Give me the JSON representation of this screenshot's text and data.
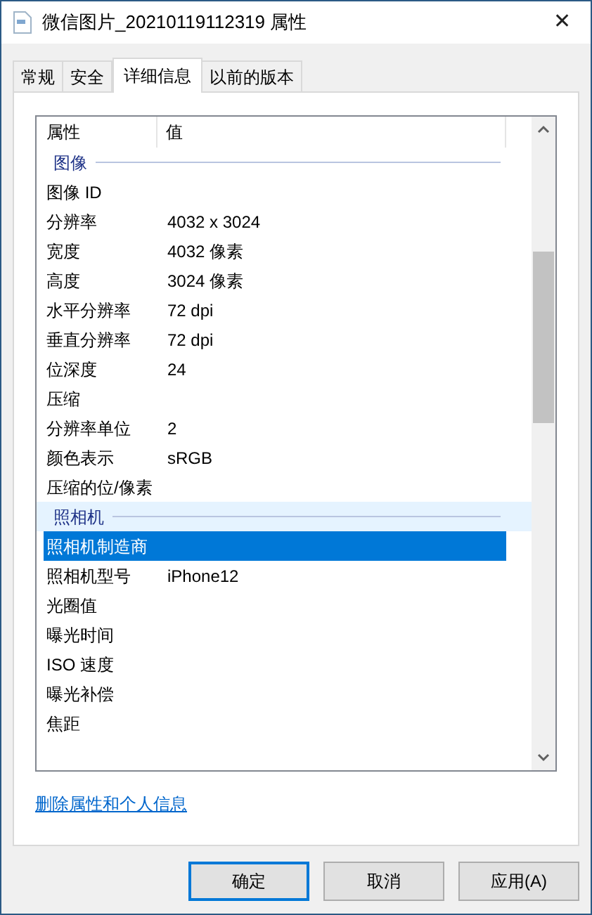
{
  "window": {
    "title": "微信图片_20210119112319 属性",
    "close": "✕"
  },
  "tabs": [
    {
      "label": "常规",
      "selected": false
    },
    {
      "label": "安全",
      "selected": false
    },
    {
      "label": "详细信息",
      "selected": true
    },
    {
      "label": "以前的版本",
      "selected": false
    }
  ],
  "table": {
    "columns": [
      "属性",
      "值"
    ],
    "rows": [
      {
        "kind": "group",
        "label": "图像",
        "highlighted": false
      },
      {
        "kind": "property",
        "name": "图像 ID",
        "selected": false
      },
      {
        "kind": "property",
        "name": "分辨率",
        "value": "4032 x 3024",
        "selected": false
      },
      {
        "kind": "property",
        "name": "宽度",
        "value": "4032 像素",
        "selected": false
      },
      {
        "kind": "property",
        "name": "高度",
        "value": "3024 像素",
        "selected": false
      },
      {
        "kind": "property",
        "name": "水平分辨率",
        "value": "72 dpi",
        "selected": false
      },
      {
        "kind": "property",
        "name": "垂直分辨率",
        "value": "72 dpi",
        "selected": false
      },
      {
        "kind": "property",
        "name": "位深度",
        "value": "24",
        "selected": false
      },
      {
        "kind": "property",
        "name": "压缩",
        "selected": false
      },
      {
        "kind": "property",
        "name": "分辨率单位",
        "value": "2",
        "selected": false
      },
      {
        "kind": "property",
        "name": "颜色表示",
        "value": "sRGB",
        "selected": false
      },
      {
        "kind": "property",
        "name": "压缩的位/像素",
        "selected": false
      },
      {
        "kind": "group",
        "label": "照相机",
        "highlighted": true
      },
      {
        "kind": "property",
        "name": "照相机制造商",
        "selected": true
      },
      {
        "kind": "property",
        "name": "照相机型号",
        "value": "iPhone12",
        "selected": false
      },
      {
        "kind": "property",
        "name": "光圈值",
        "selected": false
      },
      {
        "kind": "property",
        "name": "曝光时间",
        "selected": false
      },
      {
        "kind": "property",
        "name": "ISO 速度",
        "selected": false
      },
      {
        "kind": "property",
        "name": "曝光补偿",
        "selected": false
      },
      {
        "kind": "property",
        "name": "焦距",
        "selected": false
      }
    ]
  },
  "link": "删除属性和个人信息",
  "buttons": [
    {
      "label": "确定",
      "default": true
    },
    {
      "label": "取消",
      "default": false
    },
    {
      "label": "应用(A)",
      "default": false
    }
  ]
}
